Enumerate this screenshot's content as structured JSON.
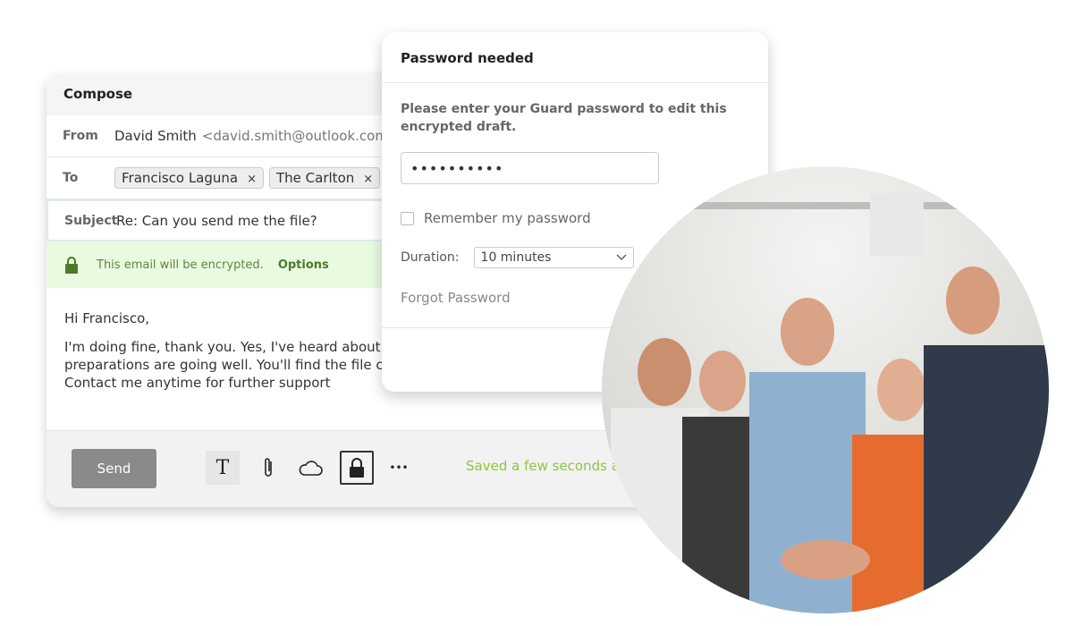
{
  "compose": {
    "title": "Compose",
    "from_label": "From",
    "from_name": "David Smith",
    "from_email": "<david.smith@outlook.com>",
    "to_label": "To",
    "recipients": [
      {
        "name": "Francisco Laguna"
      },
      {
        "name": "The Carlton"
      }
    ],
    "remove_glyph": "×",
    "subject_label": "Subject",
    "subject": "Re: Can you send me the file?",
    "encryption_notice": "This email will be encrypted.",
    "options_link": "Options",
    "body": [
      "Hi Francisco,",
      "I'm doing fine, thank you. Yes, I've heard about",
      "preparations are going well. You'll find the file co",
      "Contact me anytime for further support"
    ],
    "send_label": "Send",
    "saved_status": "Saved a few seconds ago",
    "toolbar_icons": [
      "text-format-icon",
      "paperclip-icon",
      "cloud-icon",
      "lock-icon",
      "more-icon"
    ],
    "more_glyph": "•••",
    "text_glyph": "T"
  },
  "dialog": {
    "title": "Password needed",
    "message": "Please enter your Guard password to edit this encrypted draft.",
    "password_value": "••••••••••",
    "remember_label": "Remember my password",
    "duration_label": "Duration:",
    "duration_value": "10 minutes",
    "forgot_link": "Forgot Password"
  },
  "colors": {
    "encrypted_bg": "#e8fbe1",
    "encrypted_text": "#5f8540",
    "saved_green": "#8cc63f",
    "send_bg": "#8a8a8a"
  }
}
